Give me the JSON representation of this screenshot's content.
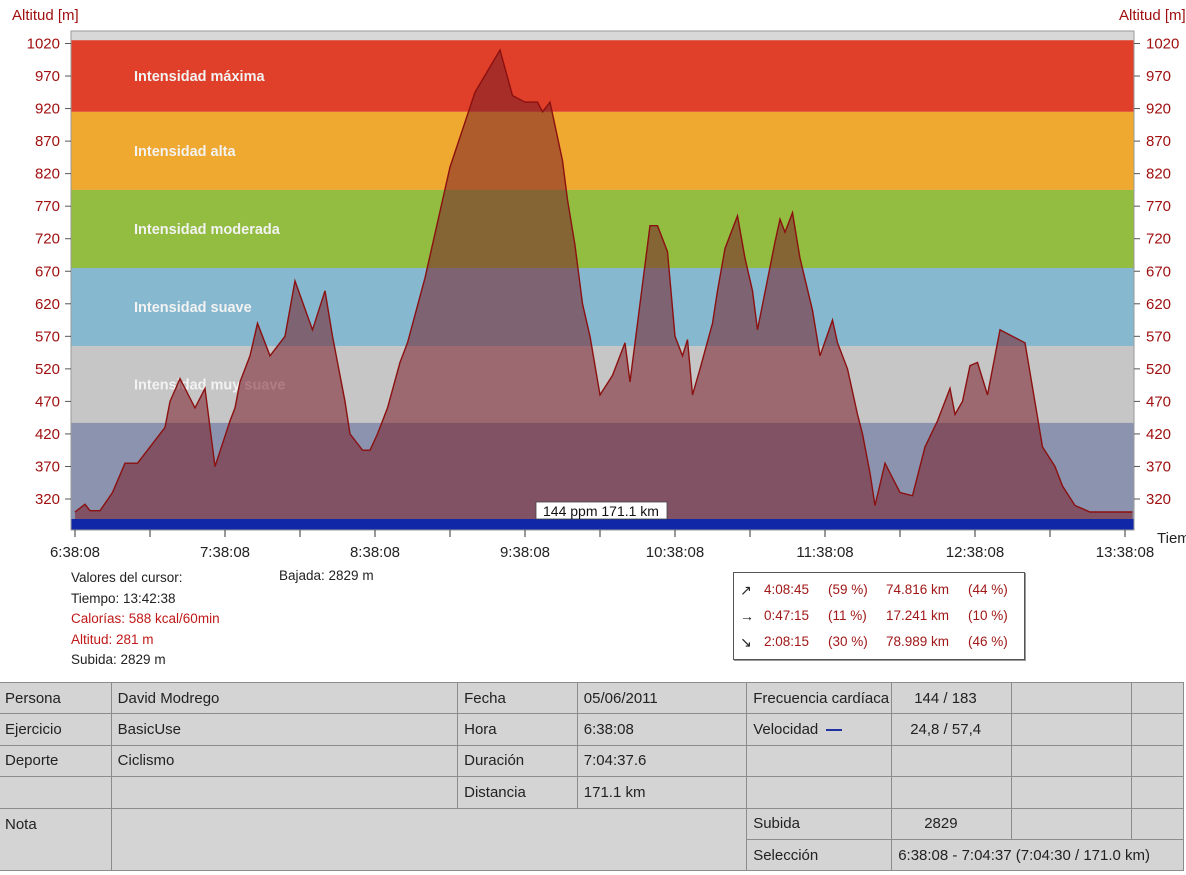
{
  "chart_data": {
    "type": "area",
    "ylabel": "Altitud [m]",
    "xlabel": "Tiempo",
    "ylim": [
      280,
      1040
    ],
    "yticks": [
      320,
      370,
      420,
      470,
      520,
      570,
      620,
      670,
      720,
      770,
      820,
      870,
      920,
      970,
      1020
    ],
    "xticks": [
      "6:38:08",
      "7:38:08",
      "8:38:08",
      "9:38:08",
      "10:38:08",
      "11:38:08",
      "12:38:08",
      "13:38:08"
    ],
    "xlim_minutes": [
      0,
      426
    ],
    "zones": [
      {
        "label": "Intensidad máxima",
        "from": 915,
        "to": 1025,
        "color": "#e0402a"
      },
      {
        "label": "Intensidad alta",
        "from": 795,
        "to": 915,
        "color": "#efa830"
      },
      {
        "label": "Intensidad moderada",
        "from": 675,
        "to": 795,
        "color": "#92bd40"
      },
      {
        "label": "Intensidad suave",
        "from": 555,
        "to": 675,
        "color": "#86b8cf"
      },
      {
        "label": "Intensidad muy suave",
        "from": 437,
        "to": 555,
        "color": "#c6c6c6"
      },
      {
        "label": "",
        "from": 280,
        "to": 437,
        "color": "#8c93ae"
      }
    ],
    "series": [
      {
        "name": "Altitud",
        "color": "#8b1010",
        "fill": "rgba(120,30,40,0.55)",
        "x": [
          0,
          4,
          6,
          10,
          15,
          20,
          25,
          30,
          36,
          38,
          42,
          48,
          52,
          56,
          62,
          64,
          66,
          70,
          73,
          78,
          84,
          88,
          95,
          100,
          103,
          108,
          110,
          115,
          118,
          121,
          125,
          130,
          133,
          140,
          150,
          160,
          170,
          175,
          180,
          185,
          187,
          190,
          195,
          197,
          200,
          203,
          206,
          210,
          215,
          220,
          222,
          225,
          230,
          233,
          237,
          240,
          243,
          245,
          247,
          250,
          255,
          257,
          260,
          265,
          268,
          271,
          273,
          280,
          282,
          284,
          287,
          290,
          295,
          298,
          303,
          305,
          309,
          313,
          315,
          318,
          320,
          324,
          330,
          335,
          340,
          345,
          350,
          352,
          355,
          358,
          361,
          365,
          370,
          380,
          387,
          392,
          395,
          400,
          406,
          410,
          414,
          420,
          423
        ],
        "y": [
          300,
          312,
          302,
          302,
          330,
          375,
          375,
          400,
          430,
          470,
          505,
          460,
          490,
          370,
          440,
          460,
          500,
          540,
          590,
          540,
          570,
          655,
          580,
          640,
          570,
          470,
          420,
          395,
          395,
          420,
          460,
          530,
          560,
          660,
          830,
          945,
          1010,
          940,
          930,
          930,
          915,
          930,
          840,
          780,
          710,
          620,
          570,
          480,
          510,
          560,
          500,
          590,
          740,
          740,
          700,
          570,
          540,
          565,
          480,
          520,
          590,
          640,
          705,
          755,
          690,
          640,
          580,
          715,
          750,
          730,
          760,
          690,
          610,
          540,
          595,
          560,
          520,
          450,
          420,
          360,
          310,
          375,
          330,
          325,
          400,
          440,
          490,
          450,
          470,
          525,
          530,
          480,
          580,
          560,
          400,
          370,
          340,
          310,
          300,
          300,
          300,
          300,
          300
        ]
      }
    ],
    "cursor_label": "144 ppm 171.1 km",
    "cursor_at_minutes": 0
  },
  "cursor_values": {
    "title": "Valores del cursor:",
    "time": "Tiempo: 13:42:38",
    "calories": "Calorías: 588 kcal/60min",
    "altitude": "Altitud: 281 m",
    "climb": "Subida: 2829 m",
    "descent": "Bajada: 2829 m"
  },
  "stats": [
    {
      "arrow": "↗",
      "time": "4:08:45",
      "time_pct": "(59 %)",
      "dist": "74.816 km",
      "dist_pct": "(44 %)"
    },
    {
      "arrow": "→",
      "time": "0:47:15",
      "time_pct": "(11 %)",
      "dist": "17.241 km",
      "dist_pct": "(10 %)"
    },
    {
      "arrow": "↘",
      "time": "2:08:15",
      "time_pct": "(30 %)",
      "dist": "78.989 km",
      "dist_pct": "(46 %)"
    }
  ],
  "info_table": {
    "persona_label": "Persona",
    "persona": "David Modrego",
    "ejercicio_label": "Ejercicio",
    "ejercicio": "BasicUse",
    "deporte_label": "Deporte",
    "deporte": "Ciclismo",
    "nota_label": "Nota",
    "fecha_label": "Fecha",
    "fecha": "05/06/2011",
    "hora_label": "Hora",
    "hora": "6:38:08",
    "duracion_label": "Duración",
    "duracion": "7:04:37.6",
    "distancia_label": "Distancia",
    "distancia": "171.1 km",
    "fc_label": "Frecuencia cardíaca",
    "fc": "144 / 183",
    "vel_label": "Velocidad",
    "vel": "24,8 / 57,4",
    "subida_label": "Subida",
    "subida": "2829",
    "seleccion_label": "Selección",
    "seleccion": "6:38:08 - 7:04:37 (7:04:30 / 171.0 km)"
  }
}
